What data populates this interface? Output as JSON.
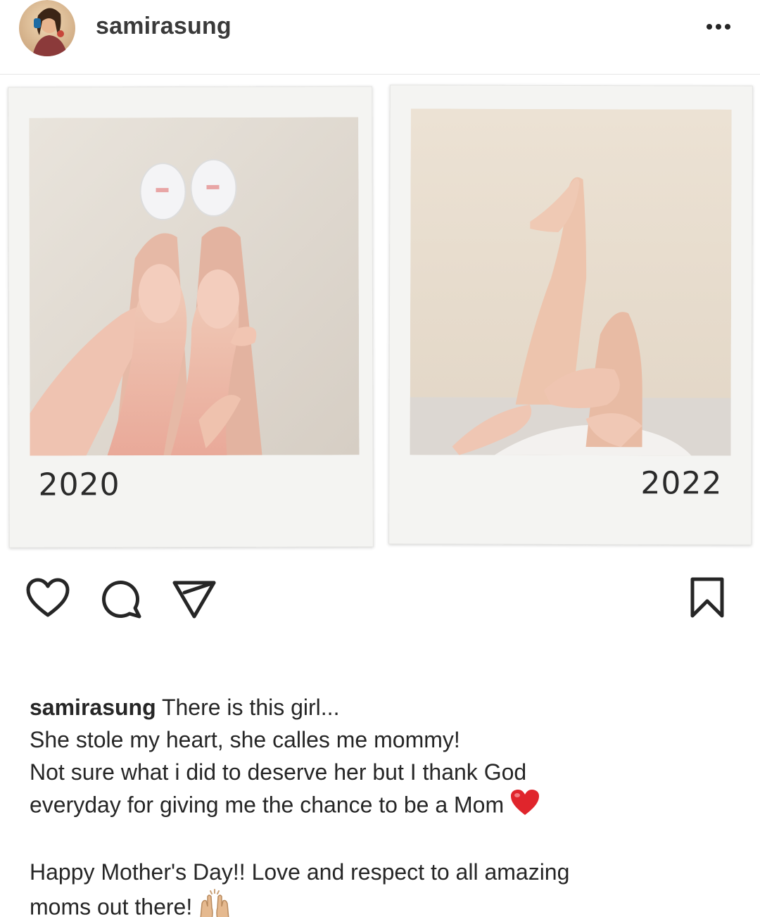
{
  "header": {
    "username": "samirasung",
    "avatar_icon": "profile-avatar",
    "more_icon": "more-horizontal-icon"
  },
  "post": {
    "photos": [
      {
        "year": "2020"
      },
      {
        "year": "2022"
      }
    ]
  },
  "actions": {
    "icons": [
      "heart-icon",
      "comment-icon",
      "share-icon",
      "bookmark-icon"
    ]
  },
  "caption": {
    "username": "samirasung",
    "line1": " There is this girl...",
    "line2": "She stole my heart, she calles me mommy!",
    "line3": "Not sure what i did to deserve her but I thank God",
    "line4": "everyday for giving me the chance to be a Mom",
    "line5": "Happy Mother's Day!! Love and respect to all amazing",
    "line6": "moms out there!",
    "emoji_heart": "red-heart-emoji",
    "emoji_hands": "raising-hands-emoji"
  },
  "colors": {
    "text": "#262626",
    "heart_emoji": "#e0252c",
    "border": "#e6e6e6"
  }
}
